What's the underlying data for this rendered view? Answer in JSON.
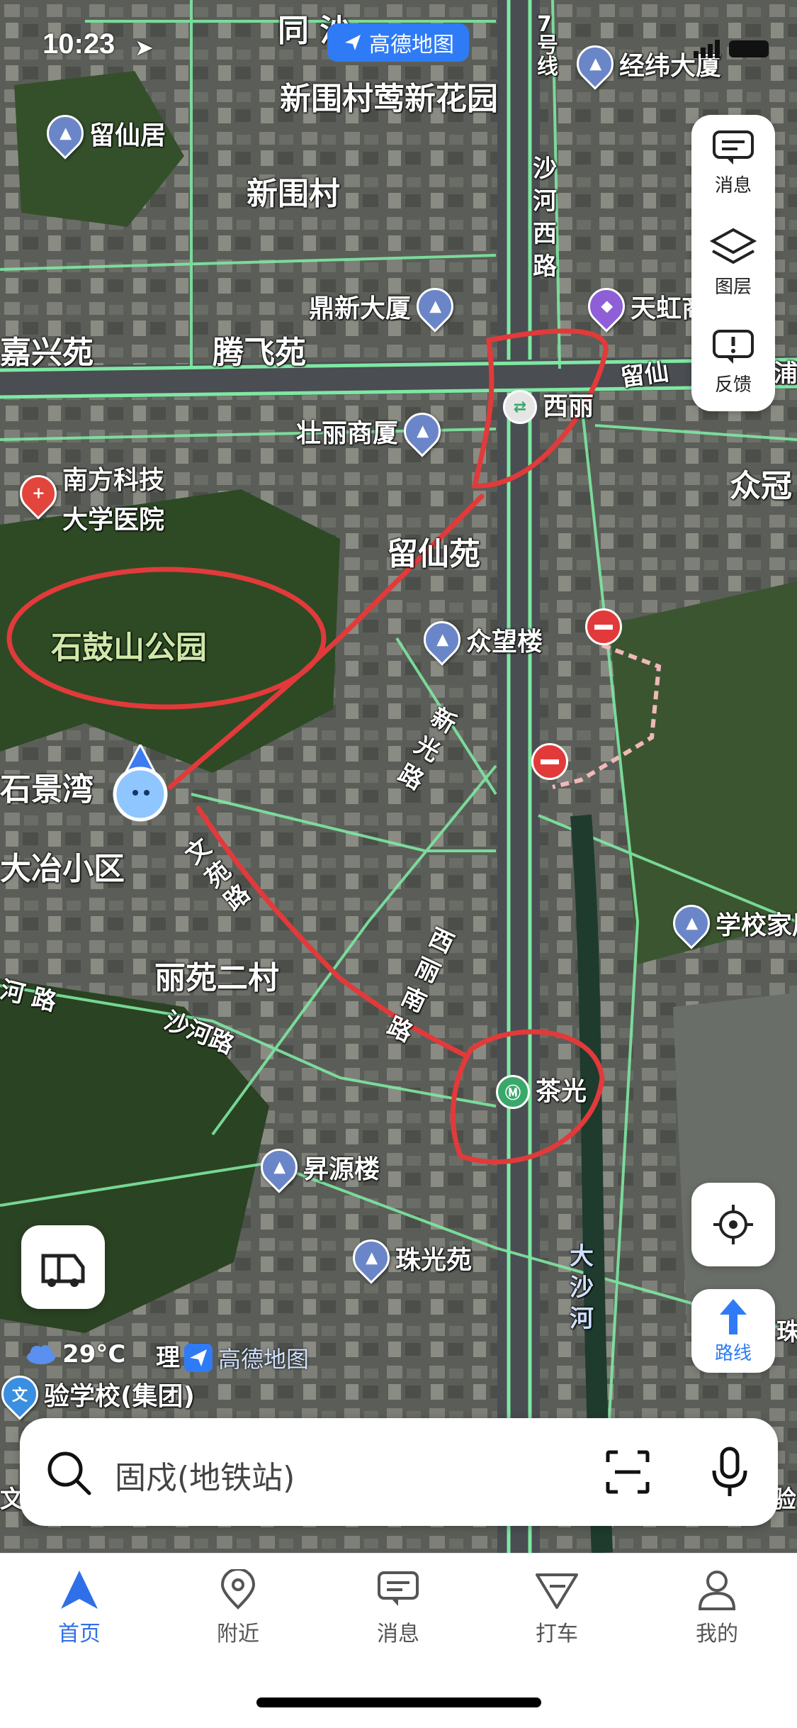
{
  "status_bar": {
    "time": "10:23"
  },
  "app": {
    "brand": "高德地图"
  },
  "map": {
    "area_labels": [
      {
        "text": "同 沙"
      },
      {
        "text": "新围村莺新花园"
      },
      {
        "text": "新围村"
      },
      {
        "text": "嘉兴苑"
      },
      {
        "text": "腾飞苑"
      },
      {
        "text": "留仙苑"
      },
      {
        "text": "石景湾"
      },
      {
        "text": "大冶小区"
      },
      {
        "text": "丽苑二村"
      },
      {
        "text": "众冠"
      }
    ],
    "road_labels": [
      {
        "text": "7号线"
      },
      {
        "text": "沙河西路"
      },
      {
        "text": "留仙"
      },
      {
        "text": "新光路"
      },
      {
        "text": "文苑路"
      },
      {
        "text": "西丽南路"
      },
      {
        "text": "沙河路"
      },
      {
        "text": "河 路"
      },
      {
        "text": "大沙河"
      },
      {
        "text": "浦"
      },
      {
        "text": "珠"
      },
      {
        "text": "理"
      },
      {
        "text": "文"
      },
      {
        "text": "验"
      }
    ],
    "park_label": "石鼓山公园",
    "pois": [
      {
        "name": "经纬大厦",
        "icon": "building-icon"
      },
      {
        "name": "留仙居",
        "icon": "building-icon"
      },
      {
        "name": "鼎新大厦",
        "icon": "building-icon"
      },
      {
        "name": "天虹商",
        "icon": "shopping-icon"
      },
      {
        "name": "壮丽商厦",
        "icon": "building-icon"
      },
      {
        "name": "南方科技大学医院",
        "line1": "南方科技",
        "line2": "大学医院",
        "icon": "hospital-icon"
      },
      {
        "name": "众望楼",
        "icon": "building-icon"
      },
      {
        "name": "学校家属",
        "icon": "building-icon"
      },
      {
        "name": "昇源楼",
        "icon": "building-icon"
      },
      {
        "name": "珠光苑",
        "icon": "building-icon"
      },
      {
        "name": "验学校(集团)",
        "icon": "school-icon"
      }
    ],
    "stations": [
      {
        "name": "西丽",
        "icon": "metro-interchange-icon"
      },
      {
        "name": "茶光",
        "icon": "metro-station-icon"
      }
    ]
  },
  "tools": {
    "messages": "消息",
    "layers": "图层",
    "feedback": "反馈",
    "route": "路线"
  },
  "weather": {
    "temp": "29°C"
  },
  "watermark": "高德地图",
  "search": {
    "placeholder": "固戍(地铁站)"
  },
  "tabs": [
    {
      "label": "首页",
      "icon": "navigate-arrow-icon",
      "active": true
    },
    {
      "label": "附近",
      "icon": "location-pin-icon",
      "active": false
    },
    {
      "label": "消息",
      "icon": "message-icon",
      "active": false
    },
    {
      "label": "打车",
      "icon": "taxi-icon",
      "active": false
    },
    {
      "label": "我的",
      "icon": "user-icon",
      "active": false
    }
  ],
  "colors": {
    "accent": "#2f6fe8",
    "road_glow": "#7ee8a2",
    "annotation": "#e23a3a"
  }
}
